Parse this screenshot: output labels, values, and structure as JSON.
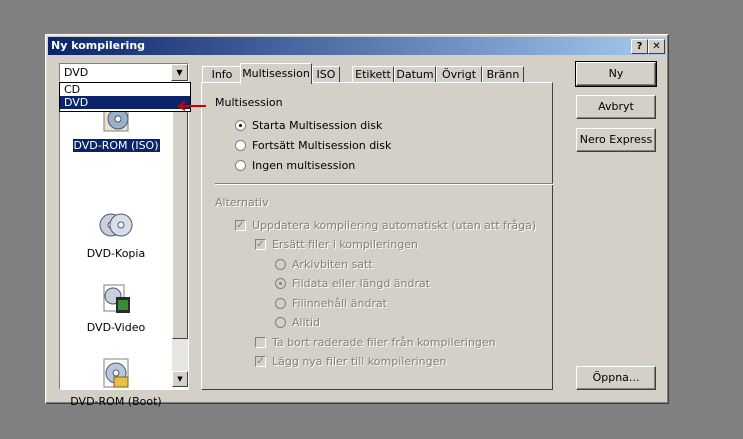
{
  "window": {
    "title": "Ny kompilering",
    "help_btn": "?",
    "close_btn": "✕"
  },
  "media_select": {
    "value": "DVD",
    "options": [
      "CD",
      "DVD"
    ],
    "active_option": "DVD"
  },
  "compilations": [
    {
      "label": "DVD-ROM (ISO)",
      "icon": "dvd-rom-iso-icon",
      "selected": true
    },
    {
      "label": "DVD-Kopia",
      "icon": "dvd-copy-icon",
      "selected": false
    },
    {
      "label": "DVD-Video",
      "icon": "dvd-video-icon",
      "selected": false
    },
    {
      "label": "DVD-ROM (Boot)",
      "icon": "dvd-rom-boot-icon",
      "selected": false
    }
  ],
  "tabs": [
    "Info",
    "Multisession",
    "ISO",
    "Etikett",
    "Datum",
    "Övrigt",
    "Bränn"
  ],
  "active_tab": "Multisession",
  "multisession": {
    "group_label": "Multisession",
    "options": [
      "Starta Multisession disk",
      "Fortsätt Multisession disk",
      "Ingen multisession"
    ],
    "selected": "Starta Multisession disk"
  },
  "alternativ": {
    "group_label": "Alternativ",
    "auto_update": "Uppdatera kompilering automatiskt (utan att fråga)",
    "replace_files": "Ersätt filer i kompileringen",
    "replace_options": [
      "Arkivbiten satt",
      "Fildata eller längd ändrat",
      "Filinnehåll ändrat",
      "Alltid"
    ],
    "replace_selected": "Fildata eller längd ändrat",
    "remove_deleted": "Ta bort raderade filer från kompileringen",
    "add_new": "Lägg nya filer till kompileringen"
  },
  "buttons": {
    "new": "Ny",
    "cancel": "Avbryt",
    "nero_express": "Nero Express",
    "open": "Öppna..."
  },
  "colors": {
    "title_start": "#0a246a",
    "title_end": "#a6caf0",
    "face": "#d4d0c8",
    "desktop": "#808080",
    "annotation_arrow": "#cc0000"
  }
}
